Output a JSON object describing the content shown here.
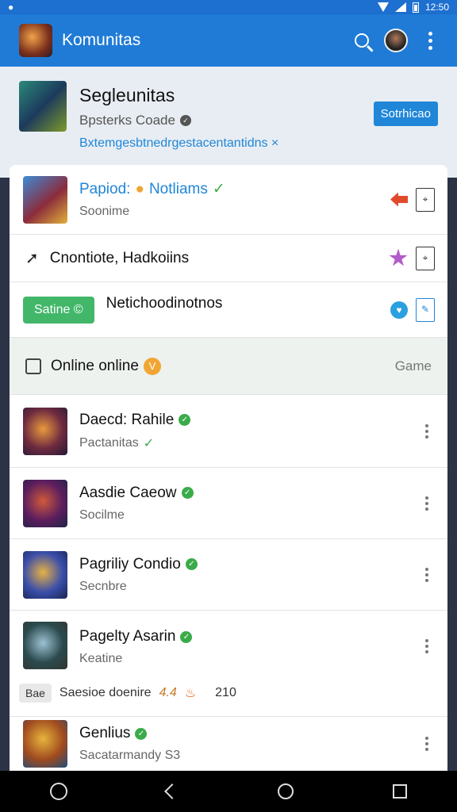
{
  "status": {
    "time": "12:50"
  },
  "app_bar": {
    "title": "Komunitas"
  },
  "header": {
    "title": "Segleunitas",
    "subtitle": "Bpsterks Coade",
    "link": "Bxtemgesbtnedrgestacentantidns ×",
    "button": "Sotrhicao"
  },
  "featured": [
    {
      "title": "Papiod:",
      "title_suffix": "Notliams",
      "subtitle": "Soonime"
    }
  ],
  "shortcut_row": {
    "label": "Cnontiote, Hadkoiins",
    "icon": "arrow-icon"
  },
  "status_row": {
    "pill": "Satine",
    "label": "Netichoodinotnos"
  },
  "online_row": {
    "label": "Online online",
    "badge": "V",
    "right": "Game"
  },
  "list": [
    {
      "title": "Daecd: Rahile",
      "subtitle": "Pactanitas"
    },
    {
      "title": "Aasdie Caeow",
      "subtitle": "Socilme"
    },
    {
      "title": "Pagriliy Condio",
      "subtitle": "Secnbre"
    },
    {
      "title": "Pagelty Asarin",
      "subtitle": "Keatine"
    },
    {
      "title": "Genlius",
      "subtitle": "Sacatarmandy S3"
    }
  ],
  "sub_row": {
    "tag": "Bae",
    "label": "Saesioe doenire",
    "rating": "4.4",
    "count": "210"
  },
  "colors": {
    "primary": "#1f7bd6",
    "accent": "#1f86d8",
    "success": "#42b76a"
  }
}
